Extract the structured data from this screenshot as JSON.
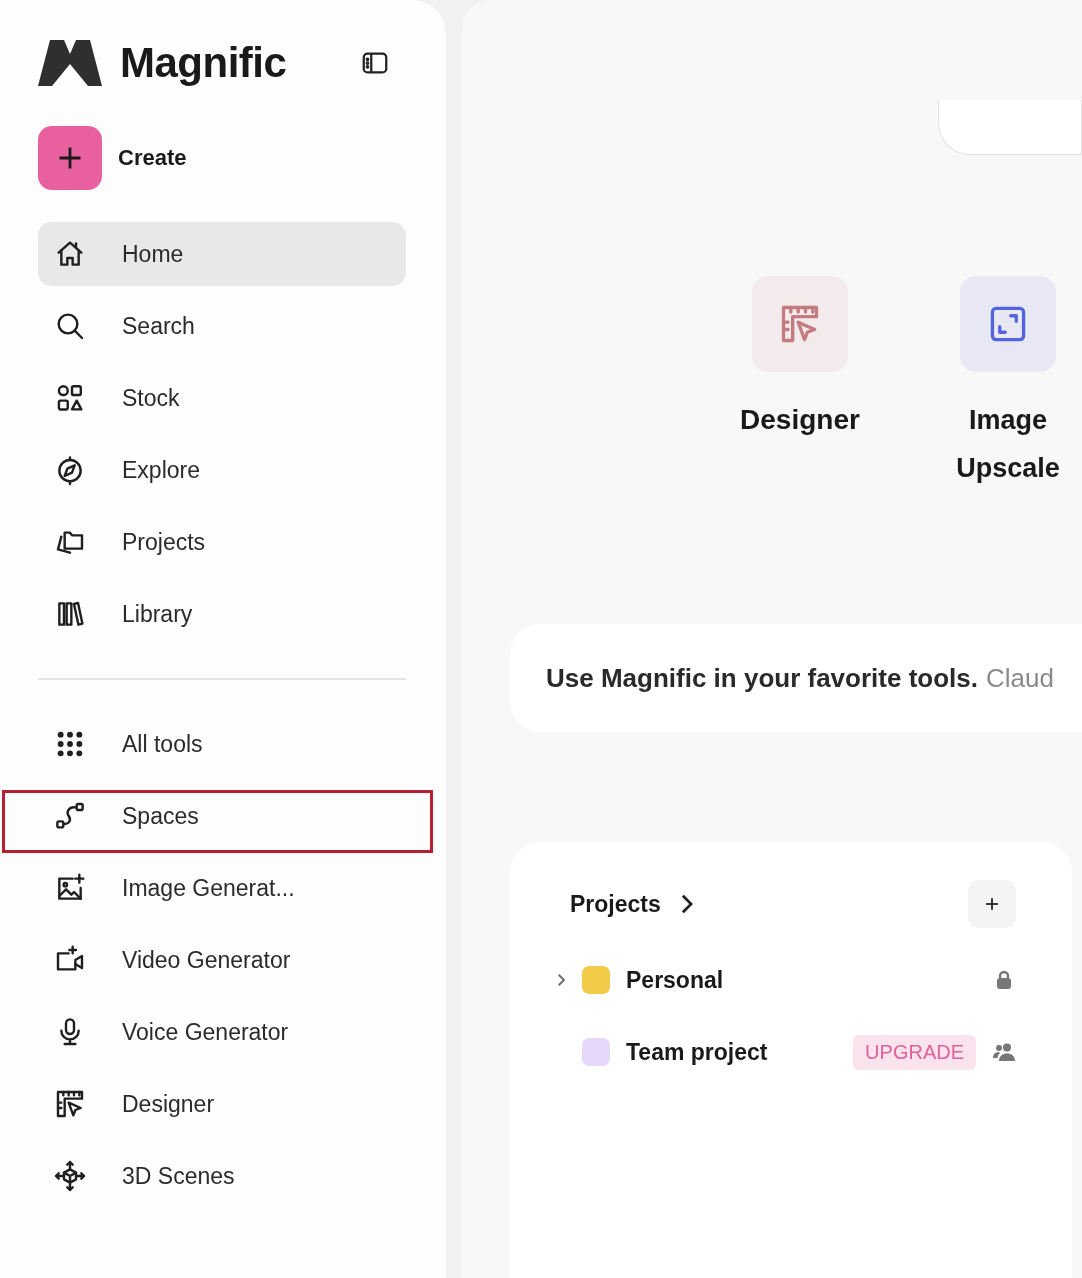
{
  "sidebar": {
    "logo": {
      "text": "Magnific"
    },
    "create": {
      "label": "Create"
    },
    "nav": [
      {
        "label": "Home",
        "selected": true,
        "highlighted": false
      },
      {
        "label": "Search",
        "selected": false,
        "highlighted": false
      },
      {
        "label": "Stock",
        "selected": false,
        "highlighted": false
      },
      {
        "label": "Explore",
        "selected": false,
        "highlighted": false
      },
      {
        "label": "Projects",
        "selected": false,
        "highlighted": false
      },
      {
        "label": "Library",
        "selected": false,
        "highlighted": false
      }
    ],
    "tools": [
      {
        "label": "All tools",
        "selected": false,
        "highlighted": false
      },
      {
        "label": "Spaces",
        "selected": false,
        "highlighted": true
      },
      {
        "label": "Image Generat...",
        "selected": false,
        "highlighted": false
      },
      {
        "label": "Video Generator",
        "selected": false,
        "highlighted": false
      },
      {
        "label": "Voice Generator",
        "selected": false,
        "highlighted": false
      },
      {
        "label": "Designer",
        "selected": false,
        "highlighted": false
      },
      {
        "label": "3D Scenes",
        "selected": false,
        "highlighted": false
      }
    ]
  },
  "main": {
    "tools": [
      {
        "label": "Designer",
        "color": "#c47a7e"
      },
      {
        "label": "Image Upscale",
        "color": "#5463dc"
      }
    ],
    "banner": {
      "text": "Use Magnific in your favorite tools.",
      "more": "Claud"
    },
    "projects": {
      "title": "Projects",
      "items": [
        {
          "name": "Personal",
          "color": "#f2cb48",
          "expandable": true,
          "kind": "private"
        },
        {
          "name": "Team project",
          "color": "#e5d8fb",
          "expandable": false,
          "badge": "UPGRADE",
          "kind": "shared"
        }
      ]
    }
  }
}
